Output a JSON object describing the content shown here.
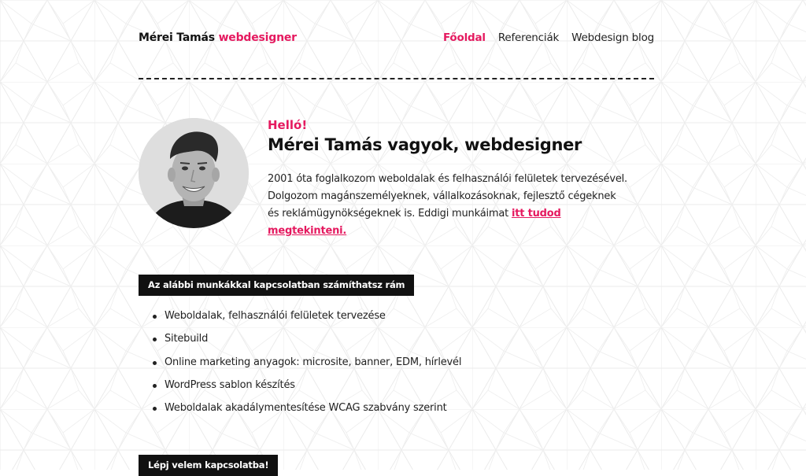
{
  "header": {
    "logo_name": "Mérei Tamás",
    "logo_role": "webdesigner",
    "nav": [
      {
        "label": "Főoldal",
        "active": true
      },
      {
        "label": "Referenciák",
        "active": false
      },
      {
        "label": "Webdesign blog",
        "active": false
      }
    ]
  },
  "hero": {
    "greeting": "Helló!",
    "headline": "Mérei Tamás vagyok, webdesigner",
    "description": "2001 óta foglalkozom weboldalak és felhasználói felületek tervezésével. Dolgozom magánszemélyeknek, vállalkozásoknak, fejlesztő cégeknek és reklámügynökségeknek is. Eddigi munkáimat",
    "link_text": "itt tudod megtekinteni."
  },
  "services": {
    "title": "Az alábbi munkákkal kapcsolatban számíthatsz rám",
    "items": [
      "Weboldalak, felhasználói felületek tervezése",
      "Sitebuild",
      "Online marketing anyagok: microsite, banner, EDM, hírlevél",
      "WordPress sablon készítés",
      "Weboldalak akadálymentesítése WCAG szabvány szerint"
    ]
  },
  "contact": {
    "title": "Lépj velem kapcsolatba!"
  },
  "colors": {
    "accent": "#e5195f",
    "text": "#111111",
    "background": "#ffffff"
  }
}
